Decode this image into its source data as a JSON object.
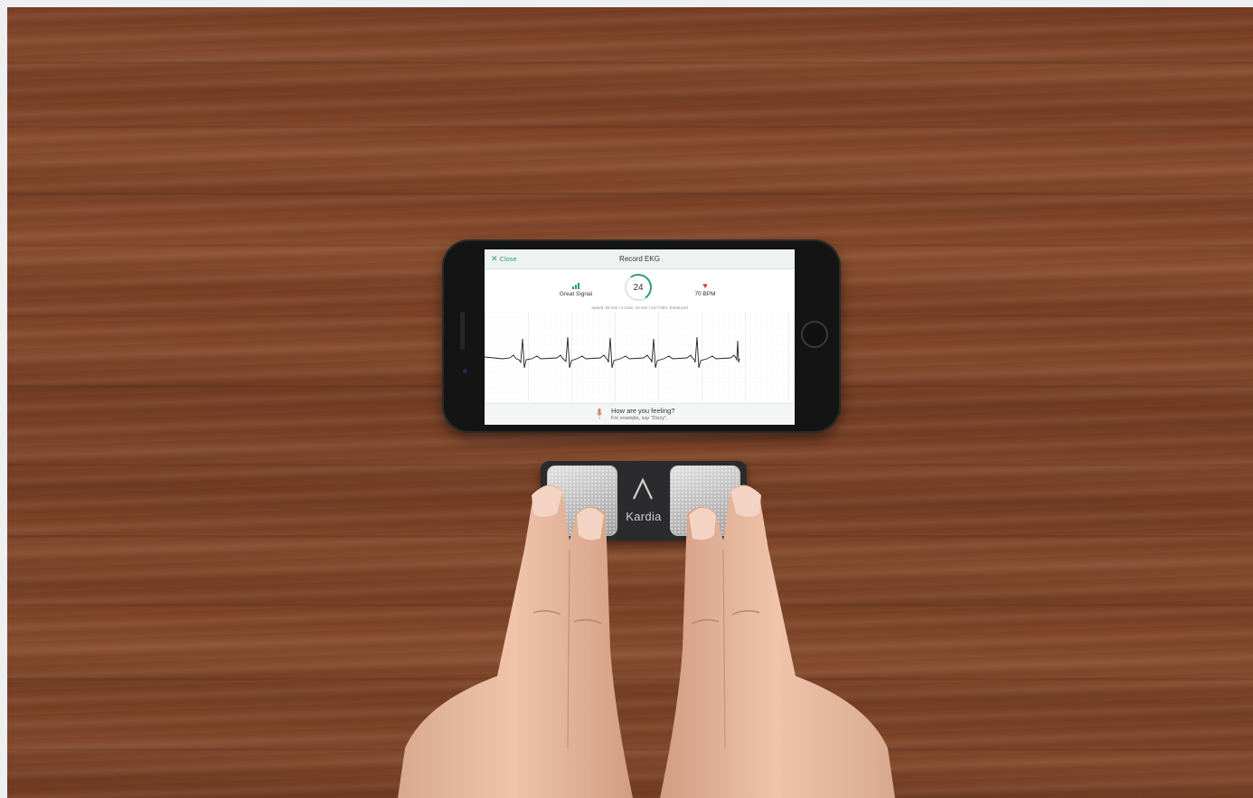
{
  "app": {
    "close_label": "Close",
    "title": "Record EKG"
  },
  "stats": {
    "signal_label": "Great Signal",
    "timer_value": "24",
    "heart_rate_label": "70 BPM"
  },
  "scale_text": "Speed: 25 mm / s     Gain: 10 mm / mV     Filter: Enhanced",
  "prompt": {
    "question": "How are you feeling?",
    "hint": "For example, say \"Dizzy\"."
  },
  "device": {
    "brand": "Kardia"
  },
  "colors": {
    "accent": "#2f9c78",
    "heart": "#e03b3b",
    "wood": "#7e4428"
  },
  "icons": [
    "close-icon",
    "signal-bars-icon",
    "heart-icon",
    "microphone-icon",
    "kardia-logo"
  ]
}
